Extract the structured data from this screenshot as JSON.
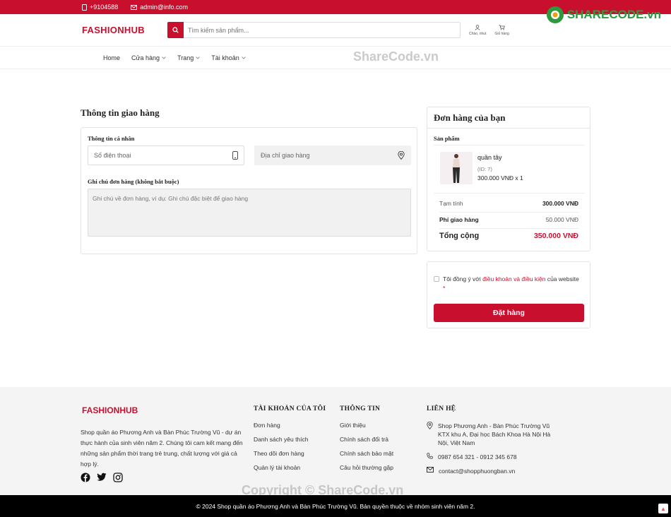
{
  "topbar": {
    "phone": "+9104588",
    "email": "admin@info.com"
  },
  "header": {
    "logo": "FASHIONHUB",
    "search_placeholder": "Tìm kiếm sản phẩm...",
    "account_label": "Chào, nhut",
    "cart_label": "Giỏ hàng"
  },
  "nav": {
    "items": [
      "Home",
      "Cửa hàng",
      "Trang",
      "Tài khoản"
    ]
  },
  "watermarks": {
    "brand": "SHARECODE.vn",
    "center": "ShareCode.vn",
    "copyright": "Copyright © ShareCode.vn"
  },
  "shipping": {
    "title": "Thông tin giao hàng",
    "personal_label": "Thông tin cá nhân",
    "phone_placeholder": "Số điện thoại",
    "address_placeholder": "Địa chỉ giao hàng",
    "note_label": "Ghi chú đơn hàng (không bắt buộc)",
    "note_placeholder": "Ghi chú về đơn hàng, ví dụ: Ghi chú đặc biệt để giao hàng"
  },
  "order": {
    "title": "Đơn hàng của bạn",
    "products_label": "Sản phẩm",
    "item": {
      "name": "quần tây",
      "id": "(ID: 7)",
      "price_qty": "300.000 VNĐ x 1"
    },
    "subtotal_label": "Tạm tính",
    "subtotal": "300.000 VNĐ",
    "shipping_label": "Phí giao hàng",
    "shipping": "50.000 VNĐ",
    "total_label": "Tổng cộng",
    "total": "350.000 VNĐ"
  },
  "terms": {
    "prefix": "Tôi đồng ý với ",
    "link": "điều khoản và điều kiện",
    "suffix": " của website ",
    "required": "*",
    "button": "Đặt hàng"
  },
  "footer": {
    "logo": "FASHIONHUB",
    "description": "Shop quần áo Phương Anh và Bàn Phúc Trường Vũ - dự án thực hành của sinh viên năm 2. Chúng tôi cam kết mang đến những sản phẩm thời trang trẻ trung, chất lượng với giá cả hợp lý.",
    "account_title": "TÀI KHOẢN CỦA TÔI",
    "account_links": [
      "Đơn hàng",
      "Danh sách yêu thích",
      "Theo dõi đơn hàng",
      "Quản lý tài khoản"
    ],
    "info_title": "THÔNG TIN",
    "info_links": [
      "Giới thiệu",
      "Chính sách đổi trả",
      "Chính sách bảo mật",
      "Câu hỏi thường gặp"
    ],
    "contact_title": "LIÊN HỆ",
    "address": "Shop Phương Anh - Bàn Phúc Trường Vũ KTX khu A, Đại học Bách Khoa Hà Nội Hà Nội, Việt Nam",
    "phones": "0987 654 321 - 0912 345 678",
    "email": "contact@shopphuongban.vn",
    "copyright": "© 2024 Shop quần áo Phương Anh và Bàn Phúc Trường Vũ. Bản quyền thuộc về nhóm sinh viên năm 2."
  },
  "colors": {
    "brand": "#c8102e",
    "footer_bg": "#f4f4f4",
    "bottom_bar": "#000000"
  }
}
